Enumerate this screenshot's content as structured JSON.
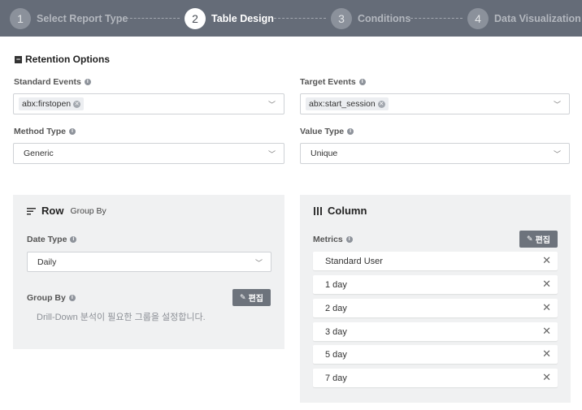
{
  "stepper": {
    "steps": [
      {
        "num": "1",
        "label": "Select Report Type"
      },
      {
        "num": "2",
        "label": "Table Design"
      },
      {
        "num": "3",
        "label": "Conditions"
      },
      {
        "num": "4",
        "label": "Data Visualization"
      }
    ],
    "active_step": 2
  },
  "retention": {
    "title": "Retention Options",
    "standard_events": {
      "label": "Standard Events",
      "tags": [
        "abx:firstopen"
      ]
    },
    "target_events": {
      "label": "Target Events",
      "tags": [
        "abx:start_session"
      ]
    },
    "method_type": {
      "label": "Method Type",
      "value": "Generic"
    },
    "value_type": {
      "label": "Value Type",
      "value": "Unique"
    }
  },
  "row_panel": {
    "title": "Row",
    "subtitle": "Group By",
    "date_type": {
      "label": "Date Type",
      "value": "Daily"
    },
    "group_by": {
      "label": "Group By",
      "hint": "Drill-Down 분석이 필요한 그룹을 설정합니다."
    },
    "edit_label": "편집"
  },
  "column_panel": {
    "title": "Column",
    "metrics_label": "Metrics",
    "edit_label": "편집",
    "metrics": [
      "Standard User",
      "1 day",
      "2 day",
      "3 day",
      "5 day",
      "7 day"
    ]
  },
  "colors": {
    "stepper_bg": "#656c78",
    "panel_bg": "#f0f1f2",
    "edit_button": "#6d737c"
  }
}
